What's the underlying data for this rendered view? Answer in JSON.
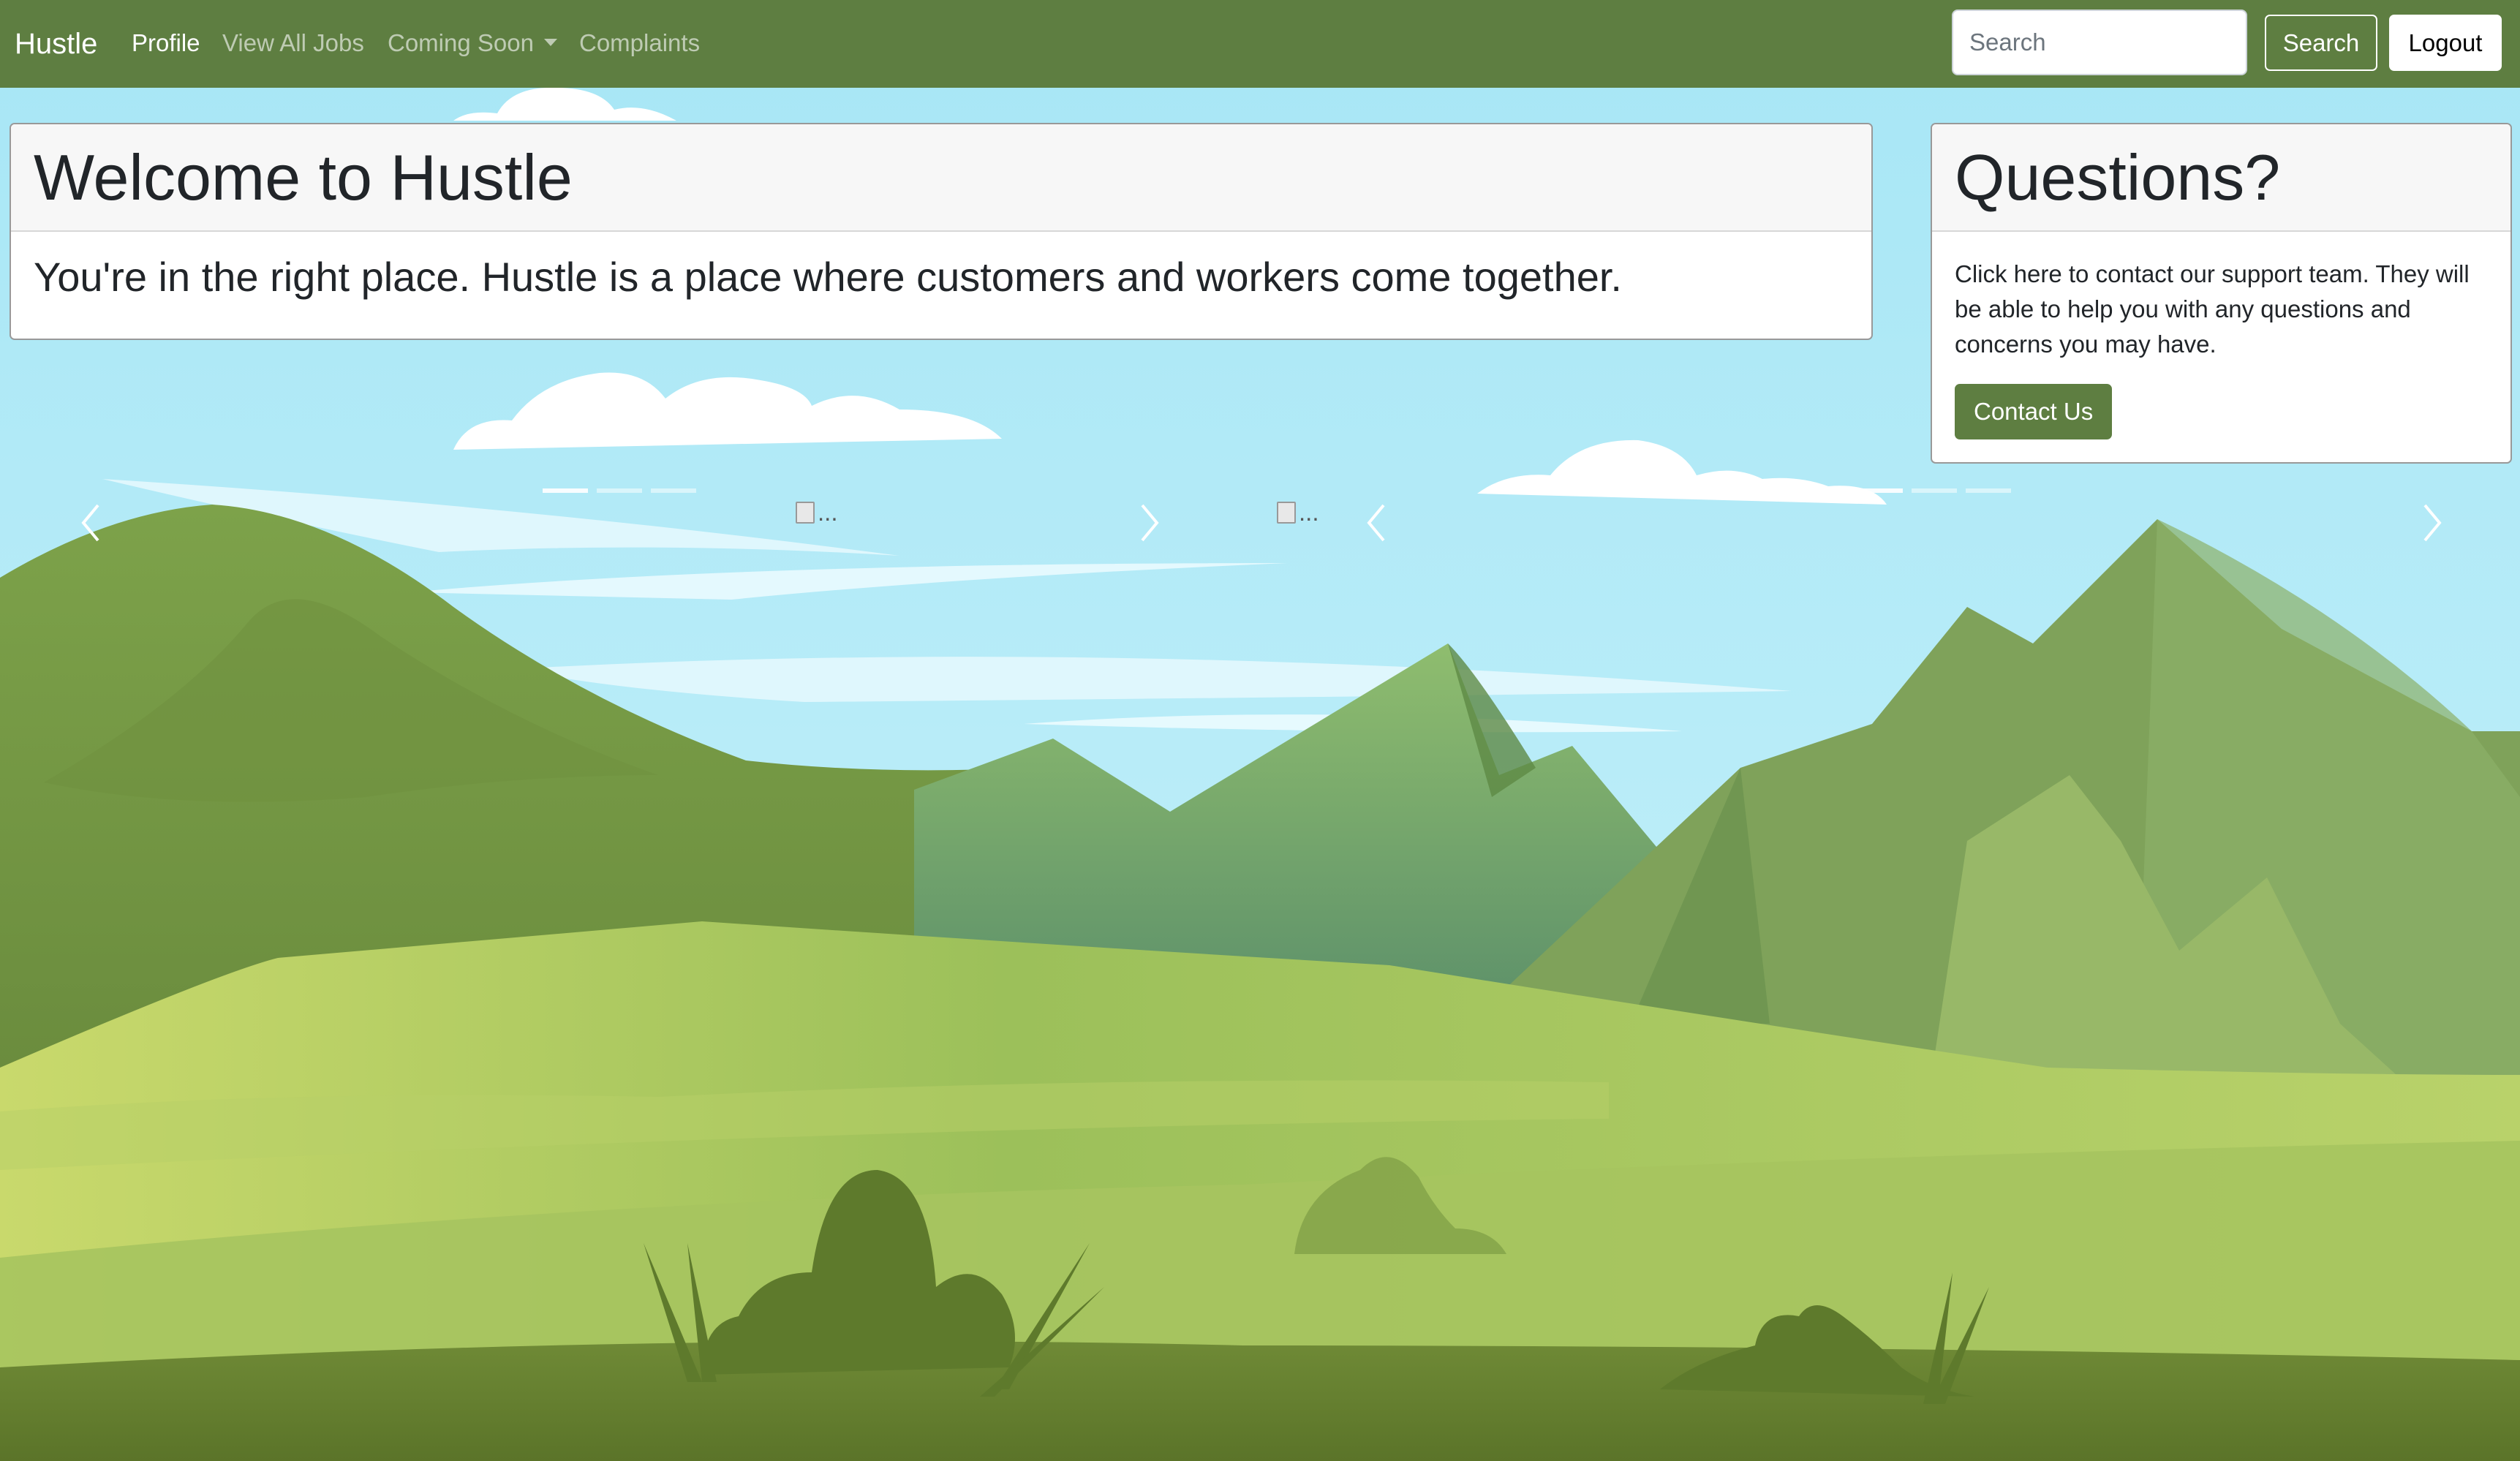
{
  "navbar": {
    "brand": "Hustle",
    "links": [
      {
        "label": "Profile",
        "active": true
      },
      {
        "label": "View All Jobs",
        "active": false
      },
      {
        "label": "Coming Soon",
        "active": false,
        "dropdown": true
      },
      {
        "label": "Complaints",
        "active": false
      }
    ],
    "search_placeholder": "Search",
    "search_button": "Search",
    "logout_button": "Logout"
  },
  "welcome": {
    "title": "Welcome to Hustle",
    "subtitle": "You're in the right place. Hustle is a place where customers and workers come together."
  },
  "questions": {
    "title": "Questions?",
    "text": "Click here to contact our support team. They will be able to help you with any questions and concerns you may have.",
    "button": "Contact Us"
  },
  "carousels": [
    {
      "image_alt": "...",
      "indicators": 3,
      "active_indicator": 0
    },
    {
      "image_alt": "...",
      "indicators": 3,
      "active_indicator": 0
    }
  ],
  "colors": {
    "navbar": "#5e7e41",
    "primary_button": "#5e7e41",
    "sky": "#ade8f5"
  },
  "icons": {
    "prev": "chevron-left-icon",
    "next": "chevron-right-icon",
    "dropdown": "caret-down-icon"
  }
}
